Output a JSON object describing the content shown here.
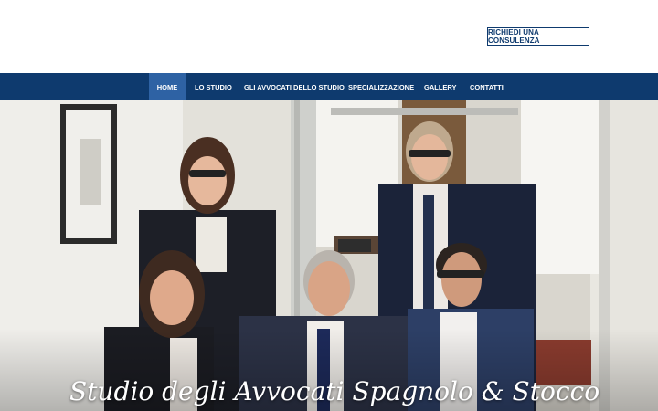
{
  "header": {
    "cta_label": "RICHIEDI UNA CONSULENZA"
  },
  "nav": {
    "items": [
      {
        "label": "HOME",
        "active": true
      },
      {
        "label": "LO STUDIO",
        "active": false
      },
      {
        "label": "GLI AVVOCATI DELLO STUDIO",
        "active": false
      },
      {
        "label": "SPECIALIZZAZIONE",
        "active": false
      },
      {
        "label": "GALLERY",
        "active": false
      },
      {
        "label": "CONTATTI",
        "active": false
      }
    ]
  },
  "hero": {
    "title": "Studio degli Avvocati Spagnolo & Stocco",
    "image": "group-photo-of-five-lawyers-in-office"
  },
  "colors": {
    "brand_navy": "#0e3a6e",
    "nav_active": "#2e62a4",
    "background": "#ffffff"
  }
}
